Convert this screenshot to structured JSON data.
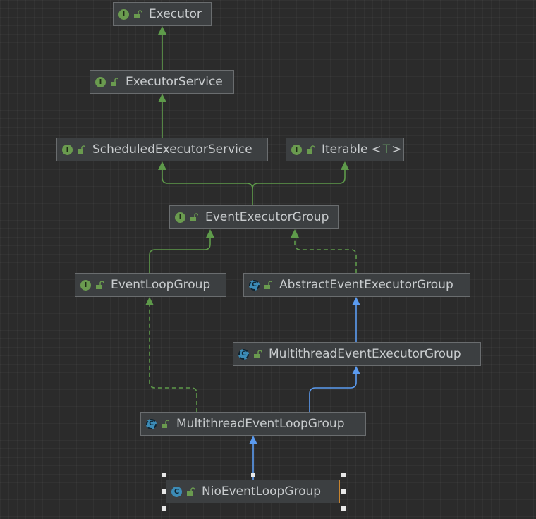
{
  "colors": {
    "background": "#2b2b2b",
    "node_bg": "#3c3f41",
    "node_border": "#6a6d6f",
    "selected_border": "#c8842f",
    "extends_interface": "#5e9a4a",
    "extends_class": "#5b9bf0",
    "implements_dashed": "#5e9a4a"
  },
  "nodes": [
    {
      "id": "executor",
      "label": "Executor",
      "kind": "interface",
      "kind_letter": "I"
    },
    {
      "id": "executor_service",
      "label": "ExecutorService",
      "kind": "interface",
      "kind_letter": "I"
    },
    {
      "id": "scheduled_executor_service",
      "label": "ScheduledExecutorService",
      "kind": "interface",
      "kind_letter": "I"
    },
    {
      "id": "iterable",
      "label": "Iterable",
      "kind": "interface",
      "kind_letter": "I",
      "generic_open": "<",
      "generic_param": "T",
      "generic_close": ">"
    },
    {
      "id": "event_executor_group",
      "label": "EventExecutorGroup",
      "kind": "interface",
      "kind_letter": "I"
    },
    {
      "id": "event_loop_group",
      "label": "EventLoopGroup",
      "kind": "interface",
      "kind_letter": "I"
    },
    {
      "id": "abstract_event_executor_group",
      "label": "AbstractEventExecutorGroup",
      "kind": "abstract",
      "kind_letter": "C"
    },
    {
      "id": "multithread_event_executor_group",
      "label": "MultithreadEventExecutorGroup",
      "kind": "abstract",
      "kind_letter": "C"
    },
    {
      "id": "multithread_event_loop_group",
      "label": "MultithreadEventLoopGroup",
      "kind": "abstract",
      "kind_letter": "C"
    },
    {
      "id": "nio_event_loop_group",
      "label": "NioEventLoopGroup",
      "kind": "class",
      "kind_letter": "C",
      "selected": true
    }
  ],
  "edges": [
    {
      "from": "executor_service",
      "to": "executor",
      "type": "extends-interface"
    },
    {
      "from": "scheduled_executor_service",
      "to": "executor_service",
      "type": "extends-interface"
    },
    {
      "from": "event_executor_group",
      "to": "scheduled_executor_service",
      "type": "extends-interface"
    },
    {
      "from": "event_executor_group",
      "to": "iterable",
      "type": "extends-interface"
    },
    {
      "from": "event_loop_group",
      "to": "event_executor_group",
      "type": "extends-interface"
    },
    {
      "from": "abstract_event_executor_group",
      "to": "event_executor_group",
      "type": "implements"
    },
    {
      "from": "multithread_event_executor_group",
      "to": "abstract_event_executor_group",
      "type": "extends-class"
    },
    {
      "from": "multithread_event_loop_group",
      "to": "multithread_event_executor_group",
      "type": "extends-class"
    },
    {
      "from": "multithread_event_loop_group",
      "to": "event_loop_group",
      "type": "implements"
    },
    {
      "from": "nio_event_loop_group",
      "to": "multithread_event_loop_group",
      "type": "extends-class"
    }
  ]
}
